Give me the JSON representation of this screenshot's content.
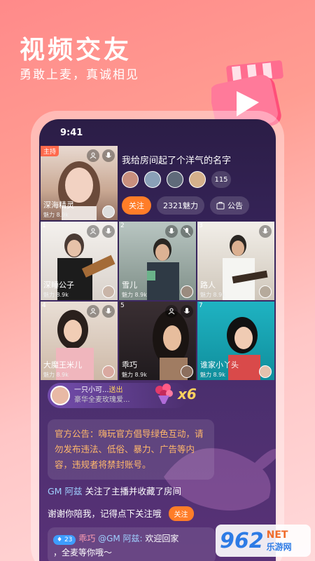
{
  "promo": {
    "title": "视频交友",
    "subtitle": "勇敢上麦，真诚相见"
  },
  "status_bar": {
    "time": "9:41"
  },
  "room": {
    "host_badge": "主持",
    "host_name": "深海精灵",
    "host_charm": "魅力 8.9k",
    "title": "我给房间起了个洋气的名字",
    "member_count": "115",
    "follow_label": "关注",
    "charm_label": "2321魅力",
    "notice_label": "公告"
  },
  "seats": [
    {
      "num": "1",
      "name": "深睡公子",
      "charm": "魅力 8.9k"
    },
    {
      "num": "2",
      "name": "雪儿",
      "charm": "魅力 8.9k"
    },
    {
      "num": "3",
      "name": "路人",
      "charm": "魅力 8.9k"
    },
    {
      "num": "4",
      "name": "大魔王米儿",
      "charm": "魅力 8.9k"
    },
    {
      "num": "5",
      "name": "乖巧",
      "charm": "魅力 8.9k"
    },
    {
      "num": "7",
      "name": "谁家小丫头",
      "charm": "魅力 8.9k"
    }
  ],
  "gift": {
    "sender": "一只小可...",
    "action": "送出",
    "desc": "豪华全麦玫瑰爱...",
    "count": "x6"
  },
  "chat": {
    "notice": "官方公告：嗨玩官方倡导绿色互动，请勿发布违法、低俗、暴力、广告等内容，违规者将禁封账号。",
    "msg1_name": "GM 阿兹",
    "msg1_text": "关注了主播并收藏了房间",
    "msg2_text": "谢谢你陪我，记得点下关注哦",
    "msg2_button": "关注",
    "msg3_level": "23",
    "msg3_sender": "乖巧",
    "msg3_mention": "@GM 阿兹:",
    "msg3_text": "欢迎回家",
    "msg3_text2": "，全麦等你哦～"
  },
  "watermark": {
    "num": "962",
    "net": "NET",
    "cn": "乐游网"
  },
  "colors": {
    "accent": "#ff7d28",
    "background_top": "#ff8a8a",
    "screen_dark": "#2b1d46"
  }
}
